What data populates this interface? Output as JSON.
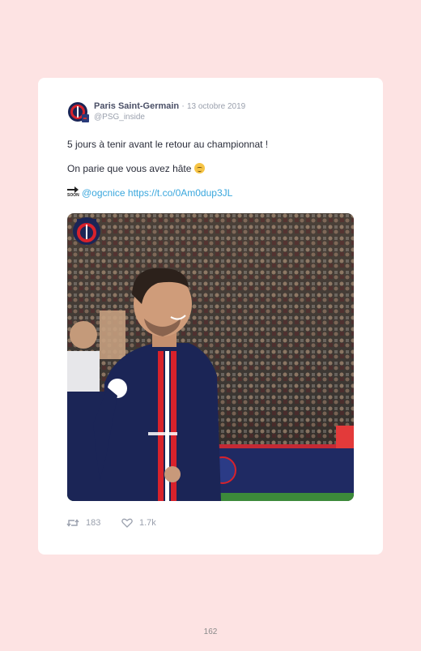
{
  "tweet": {
    "author_name": "Paris Saint-Germain",
    "separator": " · ",
    "date": "13 octobre 2019",
    "handle": "@PSG_inside",
    "line1": "5 jours à tenir avant le retour au championnat !",
    "line2": "On parie que vous avez hâte",
    "soon_label": "SOON",
    "mention": "@ogcnice",
    "link": "https://t.co/0Am0dup3JL"
  },
  "actions": {
    "retweet_count": "183",
    "like_count": "1.7k"
  },
  "colors": {
    "page_background": "#fde3e3",
    "card_background": "#ffffff",
    "link": "#3aa7dd",
    "psg_navy": "#1b2556",
    "psg_red": "#d8222b"
  },
  "icons": {
    "retweet": "retweet-icon",
    "like": "heart-icon",
    "emoji": "relieved-face-emoji",
    "soon": "soon-arrow-emoji"
  },
  "page_number": "162"
}
